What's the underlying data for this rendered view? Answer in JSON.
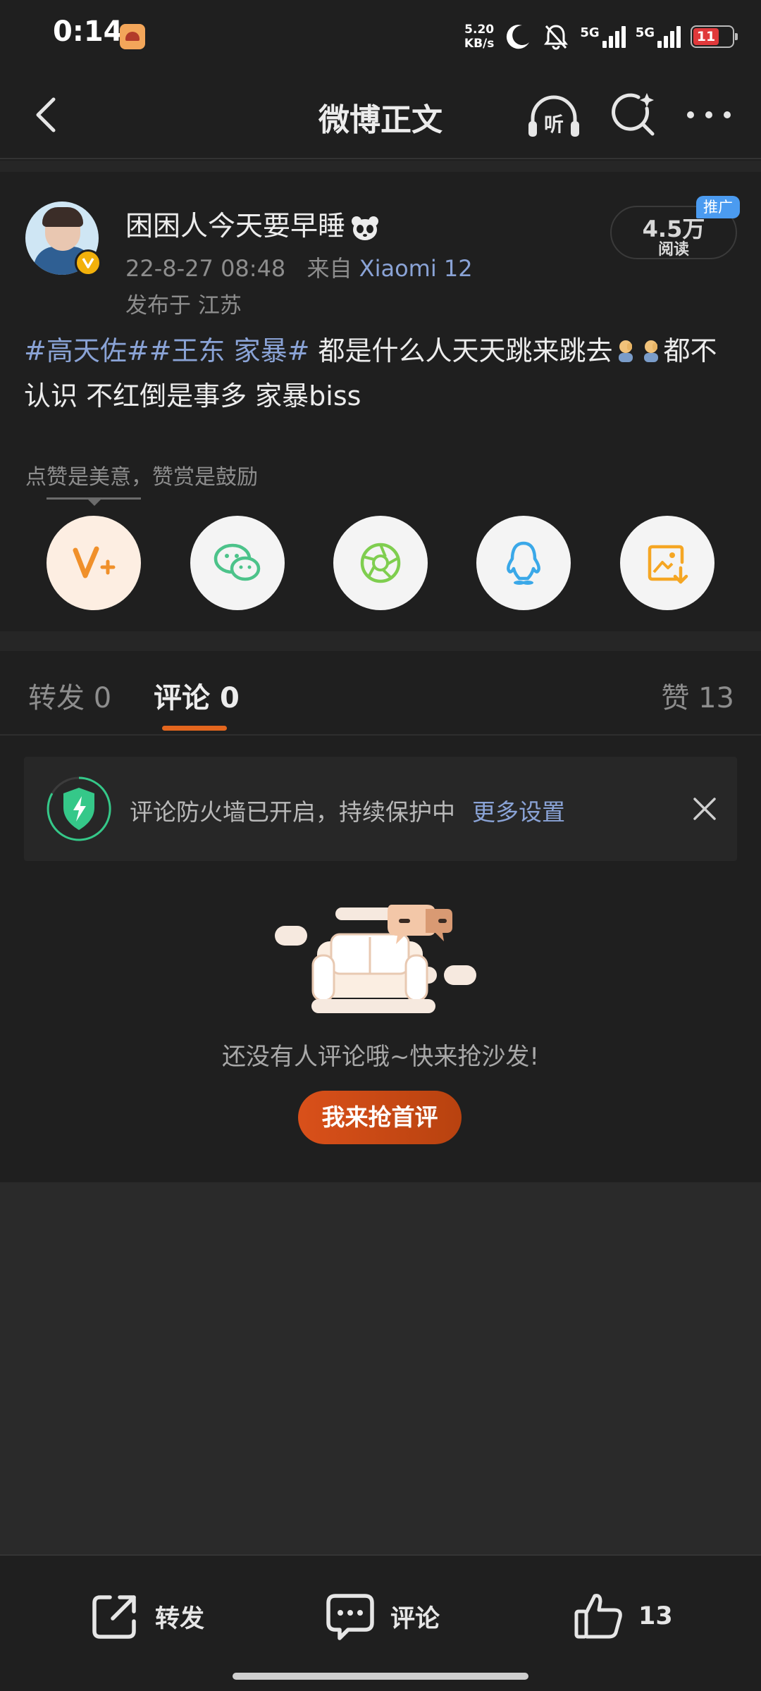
{
  "status_bar": {
    "time": "0:14",
    "net_speed_value": "5.20",
    "net_speed_unit": "KB/s",
    "sim1_label": "5G",
    "sim2_label": "5G",
    "battery_level": "11"
  },
  "header": {
    "title": "微博正文"
  },
  "post": {
    "username": "困困人今天要早睡",
    "timestamp": "22-8-27 08:48",
    "source_prefix": "来自",
    "source_device": "Xiaomi 12",
    "location": "发布于 江苏",
    "reads_count": "4.5万",
    "reads_label": "阅读",
    "promo_tag": "推广",
    "hashtag_1": "#高天佐#",
    "hashtag_2": "#王东 家暴#",
    "text_part_1": " 都是什么人天天跳来跳去",
    "text_part_2": "都不认识 不红倒是事多 家暴biss",
    "reward_caption": "点赞是美意，赞赏是鼓励"
  },
  "tabs": {
    "repost_label": "转发",
    "repost_count": "0",
    "comment_label": "评论",
    "comment_count": "0",
    "like_label": "赞",
    "like_count": "13"
  },
  "firewall": {
    "text": "评论防火墙已开启，持续保护中",
    "link": "更多设置"
  },
  "empty_state": {
    "message": "还没有人评论哦~快来抢沙发!",
    "button": "我来抢首评"
  },
  "bottom_bar": {
    "repost": "转发",
    "comment": "评论",
    "like_count": "13"
  },
  "colors": {
    "background": "#1f1f1f",
    "link_blue": "#8aa3d6",
    "accent_orange": "#e3661e",
    "firewall_green": "#35c889",
    "battery_red": "#e0393b"
  }
}
